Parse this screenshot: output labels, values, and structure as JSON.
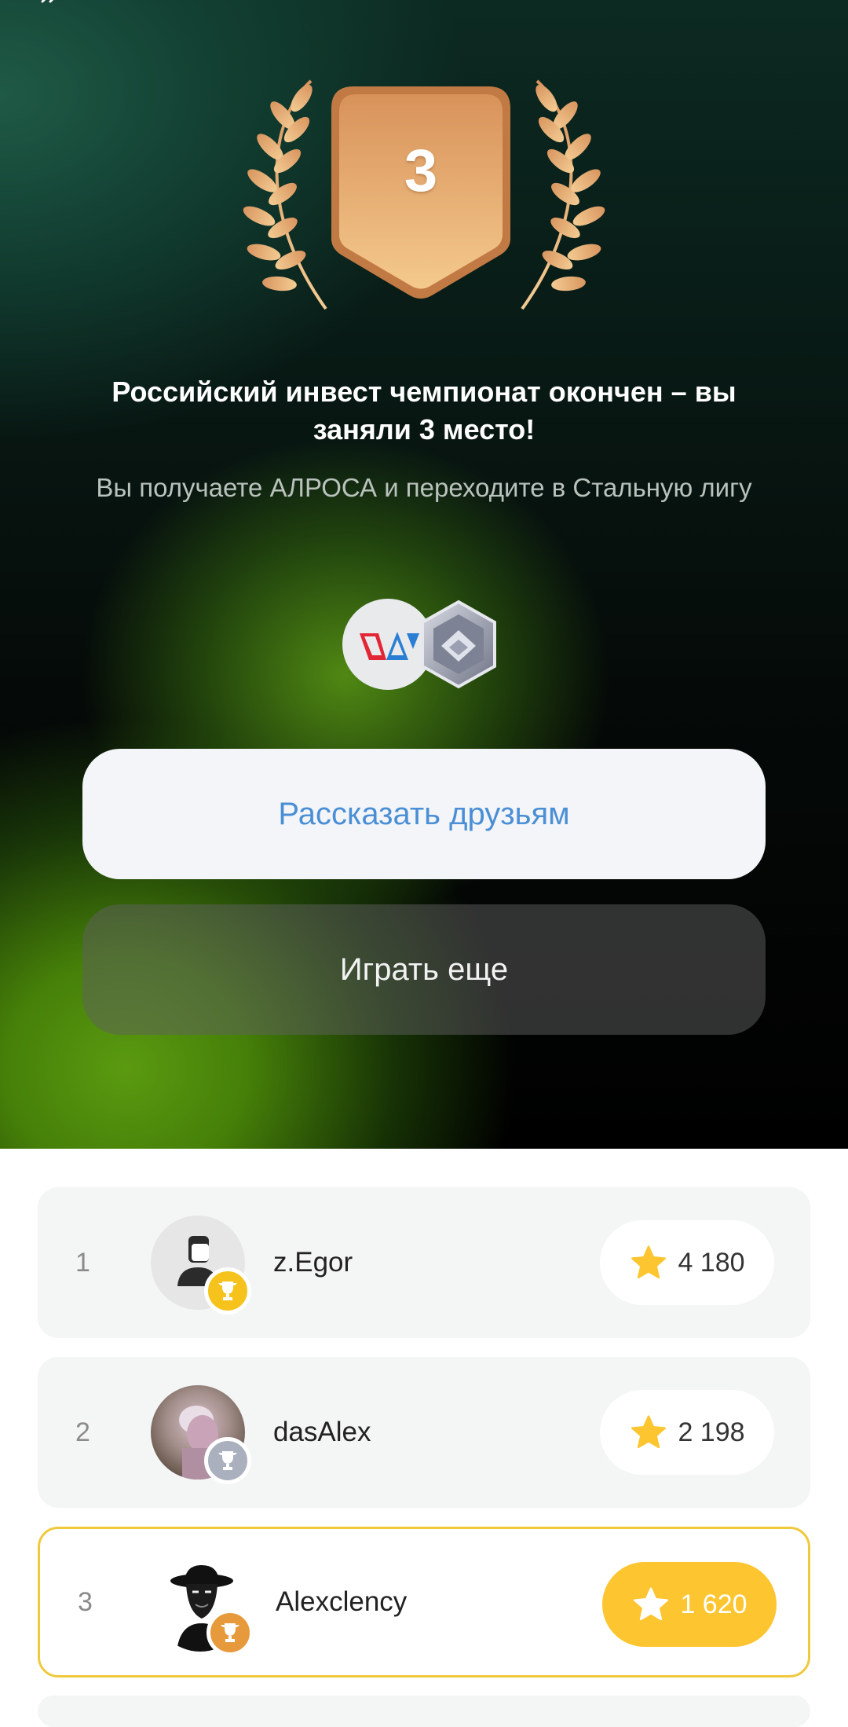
{
  "result": {
    "place": "3",
    "title": "Российский инвест чемпионат окончен – вы заняли 3 место!",
    "subtitle": "Вы получаете АЛРОСА и переходите в Стальную лигу"
  },
  "buttons": {
    "share": "Рассказать друзьям",
    "play_again": "Играть еще"
  },
  "leaderboard": [
    {
      "rank": "1",
      "name": "z.Egor",
      "score": "4 180",
      "cup": "gold"
    },
    {
      "rank": "2",
      "name": "dasAlex",
      "score": "2 198",
      "cup": "silver"
    },
    {
      "rank": "3",
      "name": "Alexclency",
      "score": "1 620",
      "cup": "bronze",
      "current": true
    }
  ],
  "colors": {
    "accent_yellow": "#fdc530",
    "link_blue": "#4a8fd6",
    "badge_bronze": "#e9a56c"
  }
}
